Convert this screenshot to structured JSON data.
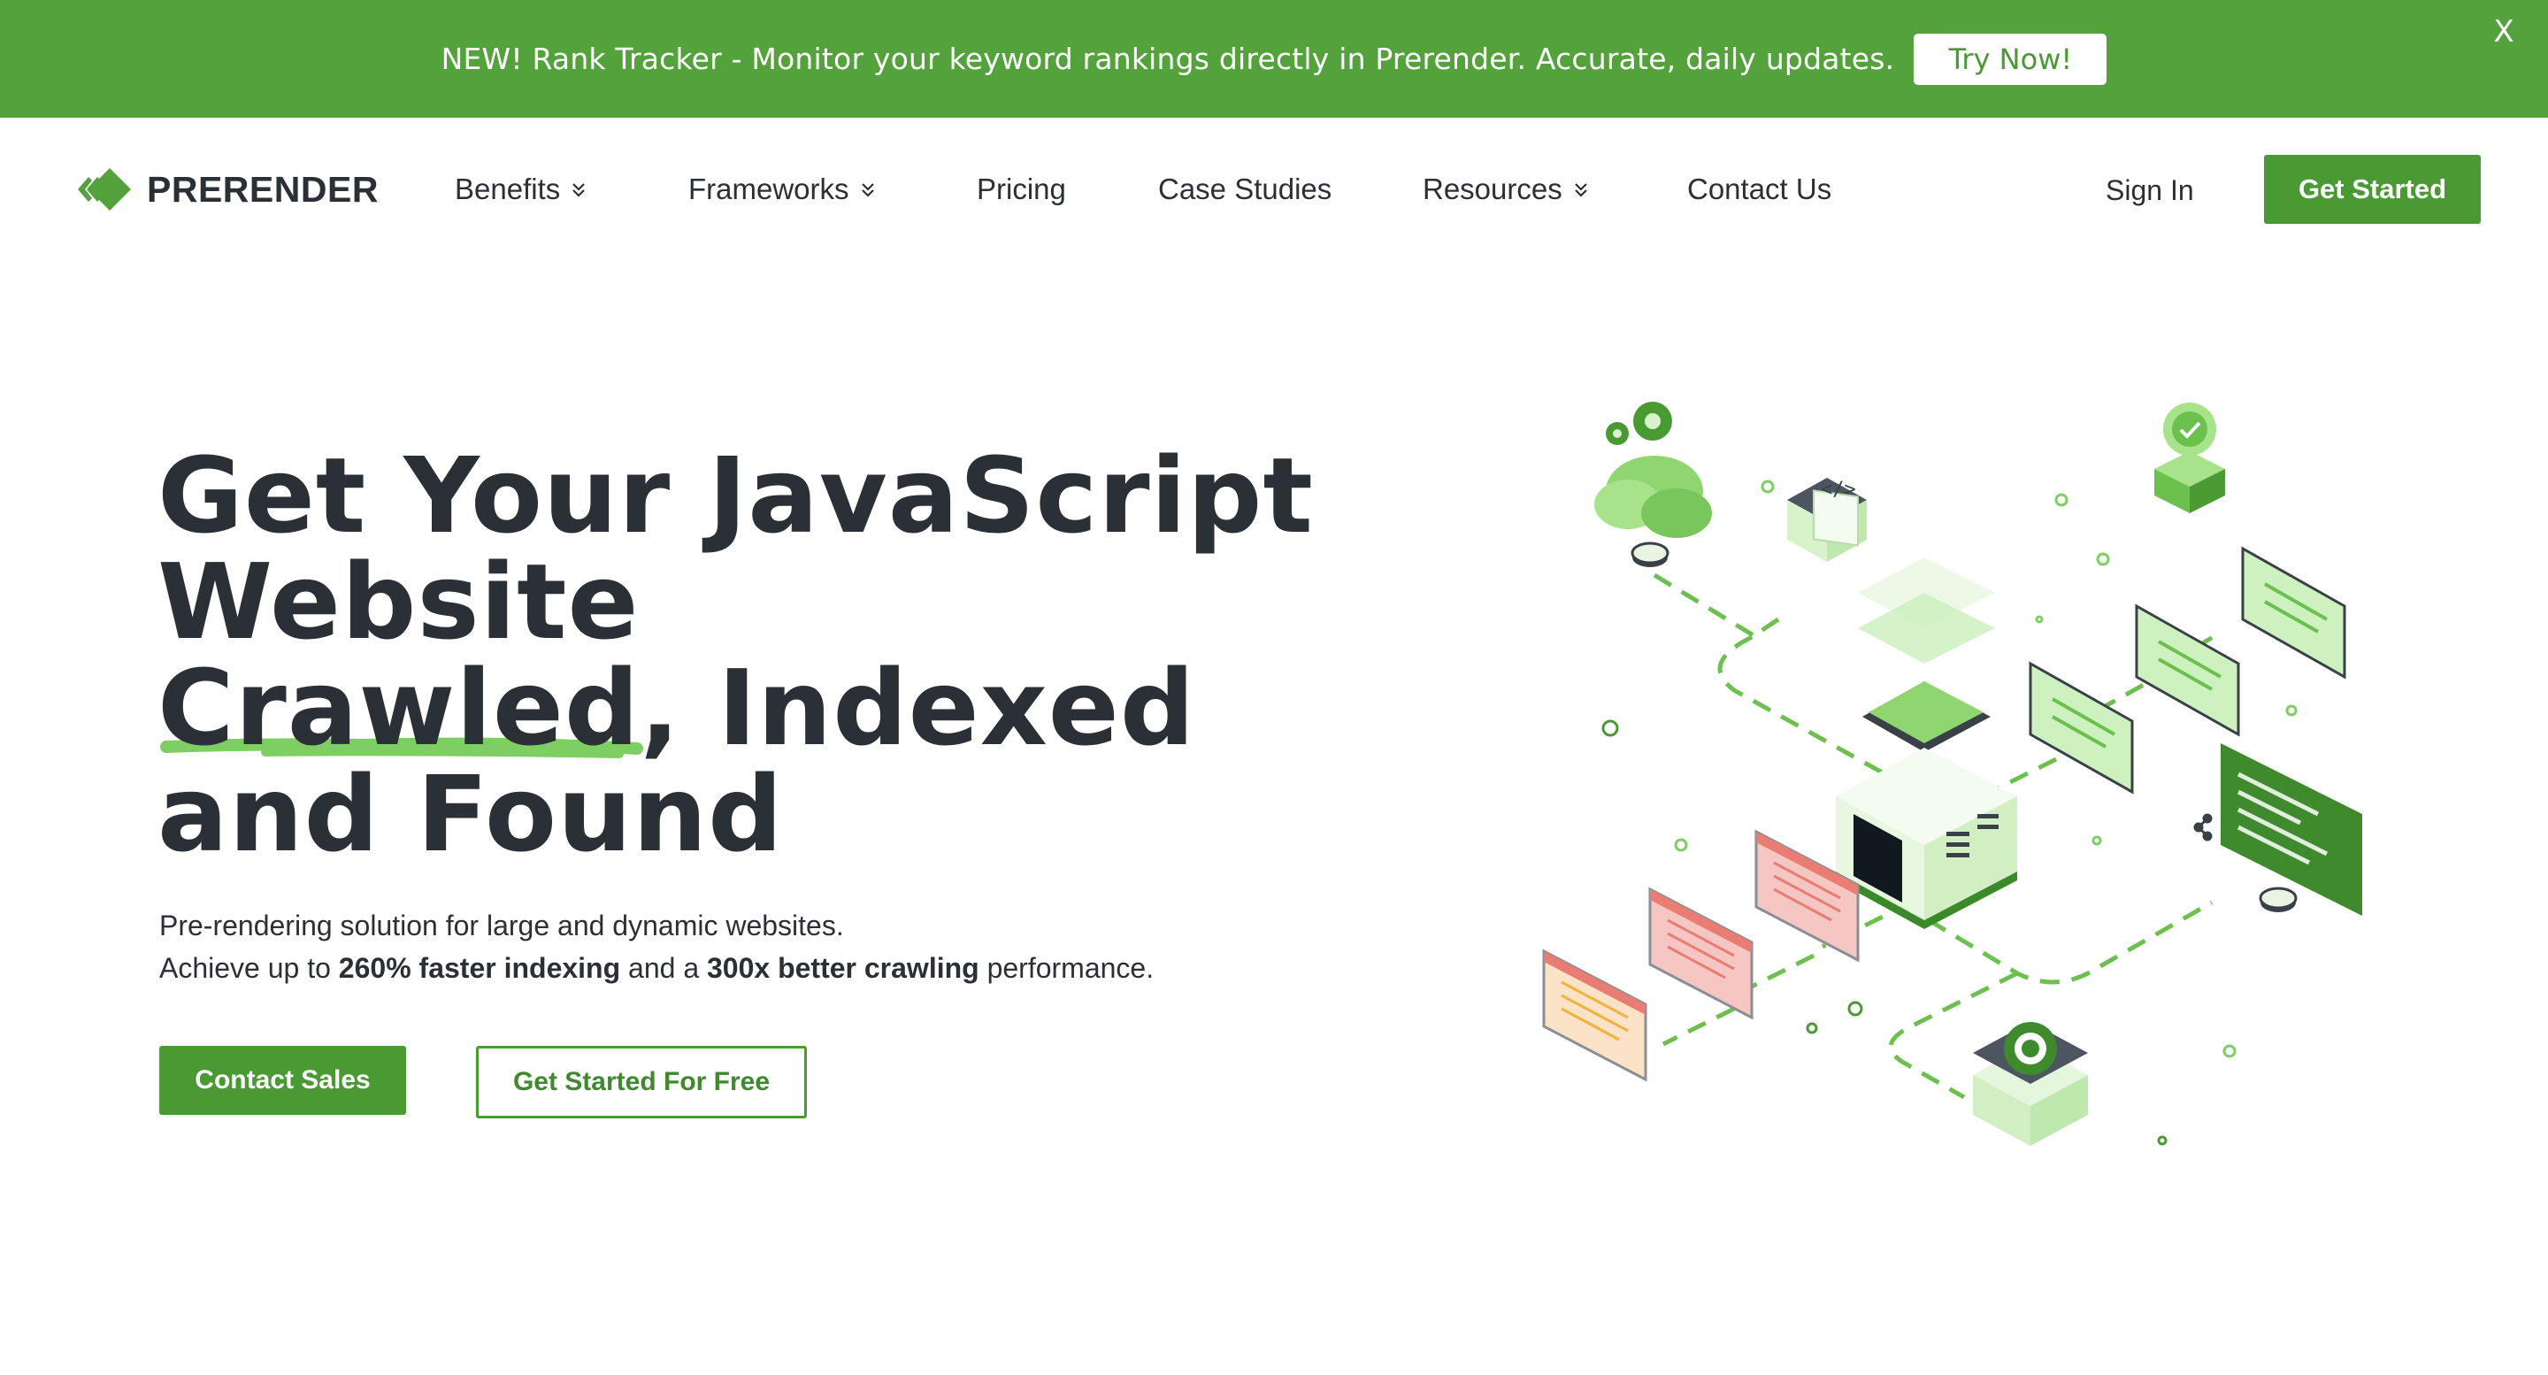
{
  "announcement": {
    "text": "NEW! Rank Tracker - Monitor your keyword rankings directly in Prerender. Accurate, daily updates.",
    "button_label": "Try Now!",
    "close_label": "X"
  },
  "header": {
    "logo_text": "PRERENDER",
    "nav": [
      {
        "label": "Benefits",
        "has_dropdown": true
      },
      {
        "label": "Frameworks",
        "has_dropdown": true
      },
      {
        "label": "Pricing",
        "has_dropdown": false
      },
      {
        "label": "Case Studies",
        "has_dropdown": false
      },
      {
        "label": "Resources",
        "has_dropdown": true
      },
      {
        "label": "Contact Us",
        "has_dropdown": false
      }
    ],
    "sign_in": "Sign In",
    "get_started": "Get Started"
  },
  "hero": {
    "title_lines": [
      "Get Your JavaScript",
      "Website",
      "Crawled, Indexed",
      "and Found"
    ],
    "subtitle_line1": "Pre-rendering solution for large and dynamic websites.",
    "subtitle_line2_pre": "Achieve up to ",
    "subtitle_line2_bold1": "260% faster indexing",
    "subtitle_line2_mid": " and a ",
    "subtitle_line2_bold2": "300x better crawling",
    "subtitle_line2_post": " performance.",
    "primary_cta": "Contact Sales",
    "secondary_cta": "Get Started For Free",
    "illustration_code_label": "</>"
  },
  "colors": {
    "brand_green": "#4a9a33",
    "banner_green": "#54a23c",
    "underline_green": "#7dcf63",
    "text_dark": "#2b2f36"
  },
  "icons": [
    "logo-diamond-icon",
    "chevron-double-down-icon",
    "close-icon",
    "gear-icon",
    "cloud-icon",
    "check-badge-icon",
    "chrome-icon",
    "server-icon",
    "code-window-icon"
  ]
}
